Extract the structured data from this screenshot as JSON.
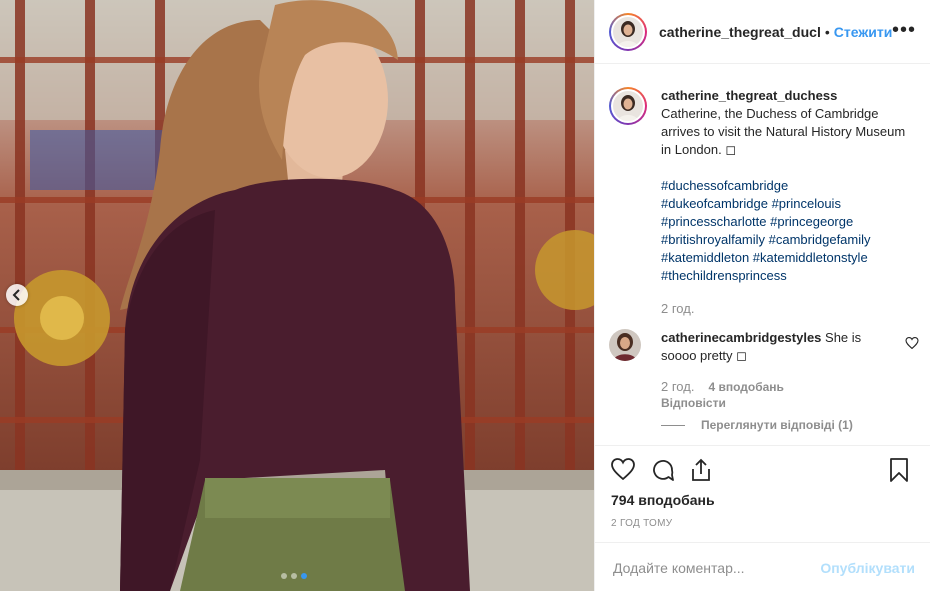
{
  "post": {
    "username": "catherine_thegreat_ducl",
    "dot": "•",
    "follow_label": "Стежити",
    "more_label": "•••"
  },
  "caption": {
    "username": "catherine_thegreat_duchess",
    "text": "Catherine, the Duchess of Cambridge arrives to visit the Natural History Museum in London. ◻",
    "hashtags": [
      "#duchessofcambridge",
      "#dukeofcambridge #princelouis",
      "#princesscharlotte #princegeorge",
      "#britishroyalfamily #cambridgefamily",
      "#katemiddleton #katemiddletonstyle",
      "#thechildrensprincess"
    ],
    "time": "2 год."
  },
  "reply": {
    "username": "catherinecambridgestyles",
    "text": " She is sоооо pretty ◻",
    "time": "2 год.",
    "likes": "4 вподобань",
    "reply_label": "Відповісти",
    "view_replies_label": "Переглянути відповіді (1)"
  },
  "actions": {
    "likes": "794 вподобань",
    "time_ago": "2 ГОД ТОМУ"
  },
  "comment_box": {
    "placeholder": "Додайте коментар...",
    "post_label": "Опублікувати"
  },
  "carousel": {
    "slide_count": 3,
    "active_index": 2
  },
  "colors": {
    "accent": "#3897f0",
    "post_disabled": "#b2dffc",
    "muted": "#8e8e8e"
  },
  "icons": {
    "like": "heart-icon",
    "comment": "comment-icon",
    "share": "share-icon",
    "save": "bookmark-icon",
    "prev": "chevron-left-icon",
    "more": "more-options-icon"
  }
}
